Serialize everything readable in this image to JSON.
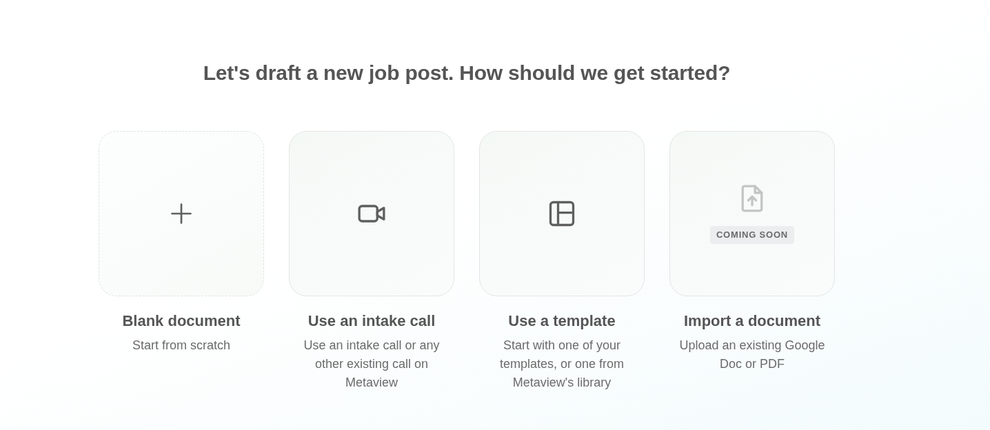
{
  "heading": "Let's draft a new job post. How should we get started?",
  "options": [
    {
      "kind": "blank",
      "title": "Blank document",
      "description": "Start from scratch",
      "disabled": false
    },
    {
      "kind": "intake",
      "title": "Use an intake call",
      "description": "Use an intake call or any other existing call on Metaview",
      "disabled": false
    },
    {
      "kind": "template",
      "title": "Use a template",
      "description": "Start with one of your templates, or one from Metaview's library",
      "disabled": false
    },
    {
      "kind": "import",
      "title": "Import a document",
      "description": "Upload an existing Google Doc or PDF",
      "disabled": true,
      "badge": "COMING SOON"
    }
  ]
}
